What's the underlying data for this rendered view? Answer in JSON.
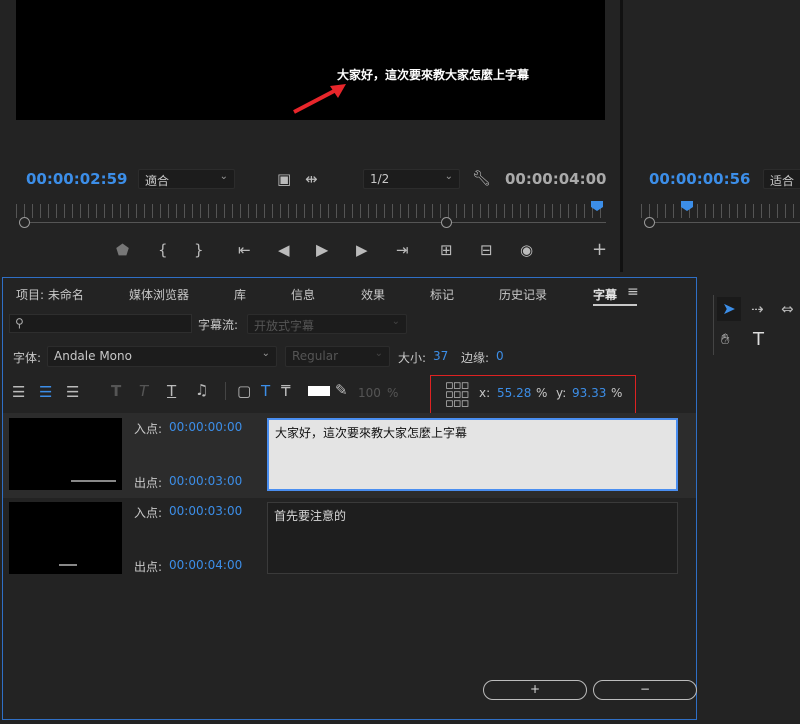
{
  "monitor": {
    "subtitle_preview": "大家好，這次要來教大家怎麼上字幕",
    "current_time": "00:00:02:59",
    "fit_select": "適合",
    "resolution_select": "1/2",
    "duration": "00:00:04:00",
    "right_time": "00:00:00:56",
    "right_fit": "适合",
    "arrow_color": "#e8262b"
  },
  "panel": {
    "tabs": [
      "项目: 未命名",
      "媒体浏览器",
      "库",
      "信息",
      "效果",
      "标记",
      "历史记录",
      "字幕"
    ],
    "menu_icon": "≡",
    "search_placeholder": "",
    "caption_stream_label": "字幕流:",
    "caption_stream_value": "开放式字幕",
    "font_label": "字体:",
    "font_value": "Andale Mono",
    "style_value": "Regular",
    "size_label": "大小:",
    "size_value": "37",
    "edge_label": "边缘:",
    "edge_value": "0",
    "opacity": "100",
    "percent": "%",
    "x_label": "x:",
    "x_value": "55.28",
    "y_label": "y:",
    "y_value": "93.33"
  },
  "captions": [
    {
      "in_label": "入点:",
      "in_time": "00:00:00:00",
      "out_label": "出点:",
      "out_time": "00:00:03:00",
      "text": "大家好，這次要來教大家怎麼上字幕"
    },
    {
      "in_label": "入点:",
      "in_time": "00:00:03:00",
      "out_label": "出点:",
      "out_time": "00:00:04:00",
      "text": "首先要注意的"
    }
  ],
  "footer": {
    "add_label": "+",
    "remove_label": "−"
  },
  "colors": {
    "accent": "#3c8ee8",
    "highlight_box": "#dd2222"
  }
}
